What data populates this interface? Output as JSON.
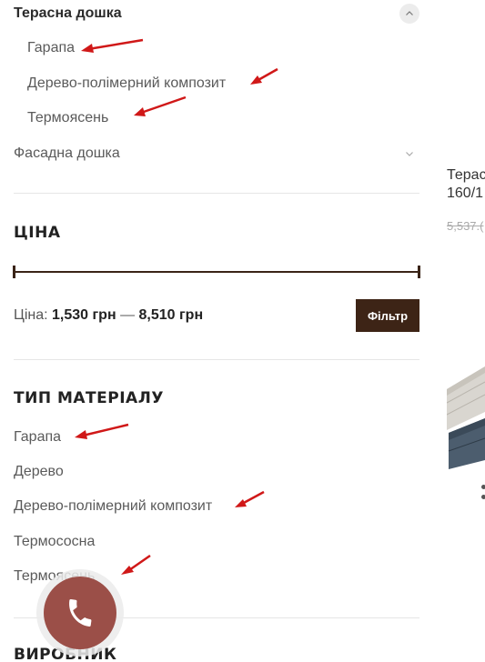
{
  "categories": {
    "terrace": {
      "label": "Терасна дошка",
      "subitems": [
        "Гарапа",
        "Дерево-полімерний композит",
        "Термоясень"
      ]
    },
    "facade": {
      "label": "Фасадна дошка"
    }
  },
  "price": {
    "title": "ЦІНА",
    "prefix": "Ціна:",
    "min": "1,530 грн",
    "dash": "—",
    "max": "8,510 грн",
    "filter_button": "Фільтр"
  },
  "material": {
    "title": "ТИП МАТЕРІАЛУ",
    "items": [
      "Гарапа",
      "Дерево",
      "Дерево-полімерний композит",
      "Термососна",
      "Термоясень"
    ]
  },
  "manufacturer": {
    "title": "ВИРОБНИК"
  },
  "product_partial": {
    "title_fragment": "Терас",
    "size_fragment": "160/1",
    "old_price_fragment": "5,537.("
  },
  "colors": {
    "accent_brown": "#3d2416",
    "call_button": "#9b4f48",
    "annotation_arrow": "#d01818"
  },
  "icons": {
    "expand_open": "chevron-up-icon",
    "expand_closed": "chevron-down-icon",
    "call": "phone-icon",
    "annotation": "red-arrow-icon"
  }
}
